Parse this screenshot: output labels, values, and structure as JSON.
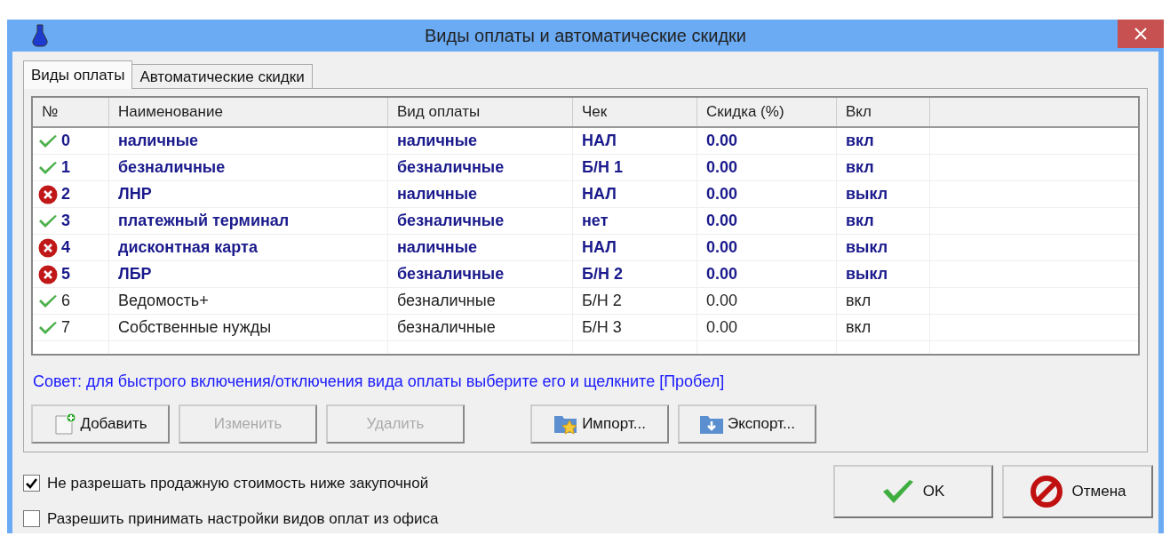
{
  "window": {
    "title": "Виды оплаты и автоматические скидки"
  },
  "tabs": [
    {
      "label": "Виды оплаты",
      "selected": true
    },
    {
      "label": "Автоматические скидки",
      "selected": false
    }
  ],
  "table": {
    "columns": [
      "№",
      "Наименование",
      "Вид оплаты",
      "Чек",
      "Скидка (%)",
      "Вкл"
    ],
    "rows": [
      {
        "enabled": true,
        "highlighted": true,
        "cells": [
          "0",
          "наличные",
          "наличные",
          "НАЛ",
          "0.00",
          "вкл"
        ]
      },
      {
        "enabled": true,
        "highlighted": true,
        "cells": [
          "1",
          "безналичные",
          "безналичные",
          "Б/Н 1",
          "0.00",
          "вкл"
        ]
      },
      {
        "enabled": false,
        "highlighted": true,
        "cells": [
          "2",
          "ЛНР",
          "наличные",
          "НАЛ",
          "0.00",
          "выкл"
        ]
      },
      {
        "enabled": true,
        "highlighted": true,
        "cells": [
          "3",
          "платежный терминал",
          "безналичные",
          "нет",
          "0.00",
          "вкл"
        ]
      },
      {
        "enabled": false,
        "highlighted": true,
        "cells": [
          "4",
          "дисконтная карта",
          "наличные",
          "НАЛ",
          "0.00",
          "выкл"
        ]
      },
      {
        "enabled": false,
        "highlighted": true,
        "cells": [
          "5",
          "ЛБР",
          "безналичные",
          "Б/Н 2",
          "0.00",
          "выкл"
        ]
      },
      {
        "enabled": true,
        "highlighted": false,
        "cells": [
          "6",
          "Ведомость+",
          "безналичные",
          "Б/Н 2",
          "0.00",
          "вкл"
        ]
      },
      {
        "enabled": true,
        "highlighted": false,
        "cells": [
          "7",
          "Собственные нужды",
          "безналичные",
          "Б/Н 3",
          "0.00",
          "вкл"
        ]
      }
    ]
  },
  "tip": "Совет: для быстрого включения/отключения вида оплаты выберите его и щелкните [Пробел]",
  "buttons": [
    {
      "kind": "add",
      "label": "Добавить",
      "disabled": false
    },
    {
      "kind": "none",
      "label": "Изменить",
      "disabled": true
    },
    {
      "kind": "none",
      "label": "Удалить",
      "disabled": true
    },
    {
      "kind": "import",
      "label": "Импорт...",
      "disabled": false
    },
    {
      "kind": "export",
      "label": "Экспорт...",
      "disabled": false
    }
  ],
  "options": [
    {
      "label": "Не разрешать продажную стоимость ниже закупочной",
      "checked": true
    },
    {
      "label": "Разрешить принимать настройки видов оплат из офиса",
      "checked": false
    }
  ],
  "dialog_buttons": [
    {
      "kind": "ok",
      "label": "OK"
    },
    {
      "kind": "cancel",
      "label": "Отмена"
    }
  ]
}
